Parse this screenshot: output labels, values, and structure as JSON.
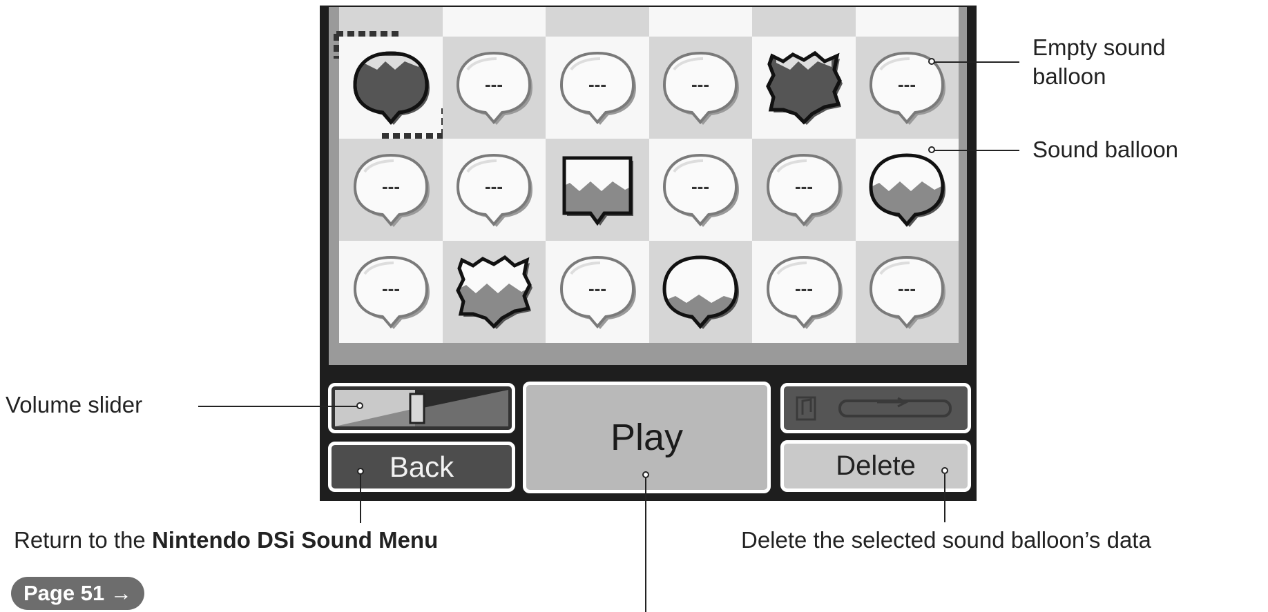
{
  "grid": {
    "rows": [
      [
        {
          "kind": "sound",
          "shape": "round-filled",
          "selected": true
        },
        {
          "kind": "empty",
          "label": "---"
        },
        {
          "kind": "empty",
          "label": "---"
        },
        {
          "kind": "empty",
          "label": "---"
        },
        {
          "kind": "sound",
          "shape": "spiky-filled"
        },
        {
          "kind": "empty",
          "label": "---"
        }
      ],
      [
        {
          "kind": "empty",
          "label": "---"
        },
        {
          "kind": "empty",
          "label": "---"
        },
        {
          "kind": "sound",
          "shape": "square-half"
        },
        {
          "kind": "empty",
          "label": "---"
        },
        {
          "kind": "empty",
          "label": "---"
        },
        {
          "kind": "sound",
          "shape": "round-outline"
        }
      ],
      [
        {
          "kind": "empty",
          "label": "---"
        },
        {
          "kind": "sound",
          "shape": "spiky-half"
        },
        {
          "kind": "empty",
          "label": "---"
        },
        {
          "kind": "sound",
          "shape": "round-outline-low"
        },
        {
          "kind": "empty",
          "label": "---"
        },
        {
          "kind": "empty",
          "label": "---"
        }
      ]
    ]
  },
  "controls": {
    "volume_level": 0.47,
    "back_label": "Back",
    "play_label": "Play",
    "delete_label": "Delete",
    "music_icon": "music-note-icon"
  },
  "callouts": {
    "empty_line1": "Empty sound",
    "empty_line2": "balloon",
    "sound_balloon": "Sound balloon",
    "volume_slider": "Volume slider",
    "return_prefix": "Return to the ",
    "return_bold": "Nintendo DSi Sound Menu",
    "page_ref": "Page 51 →",
    "delete_desc": "Delete the selected sound balloon’s data"
  },
  "colors": {
    "dark": "#1e1e1e",
    "cell_light": "#f7f7f7",
    "cell_gray": "#d6d6d6"
  }
}
